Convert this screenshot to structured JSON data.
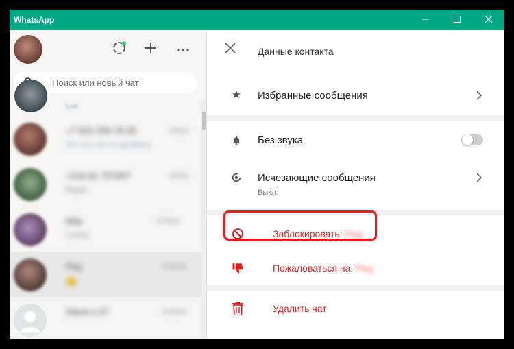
{
  "window": {
    "title": "WhatsApp",
    "minimize_icon": "minimize-icon",
    "maximize_icon": "maximize-icon",
    "close_icon": "close-icon",
    "accent": "#00a884"
  },
  "left": {
    "status_icon": "status-ring-icon",
    "new_chat_icon": "plus-icon",
    "menu_icon": "more-horizontal-icon",
    "search": {
      "placeholder": "Поиск или новый чат",
      "icon": "search-icon"
    },
    "chats": [
      {
        "name": "",
        "preview": "Lux"
      },
      {
        "name": "+7 925 256-78-35",
        "preview": "Это чат, как ты делаешь",
        "time": "вчера"
      },
      {
        "name": "+216 81 707007",
        "preview": "Видео",
        "time": "вчера"
      },
      {
        "name": "Mila",
        "preview": "стикер",
        "time": "четверг"
      },
      {
        "name": "Peg",
        "preview": "😊",
        "time": "вторник",
        "selected": true
      },
      {
        "name": "Diana и 47",
        "preview": "",
        "time": "вторник"
      }
    ]
  },
  "contact": {
    "header_title": "Данные контакта",
    "starred_label": "Избранные сообщения",
    "mute_label": "Без звука",
    "mute_on": false,
    "disappearing_label": "Исчезающие сообщения",
    "disappearing_sub": "Выкл.",
    "block_label": "Заблокировать:",
    "block_name": "Peg",
    "report_label": "Пожаловаться на:",
    "report_name": "Peg",
    "delete_label": "Удалить чат",
    "danger_color": "#e02020",
    "highlight_color": "#e41d1d"
  }
}
